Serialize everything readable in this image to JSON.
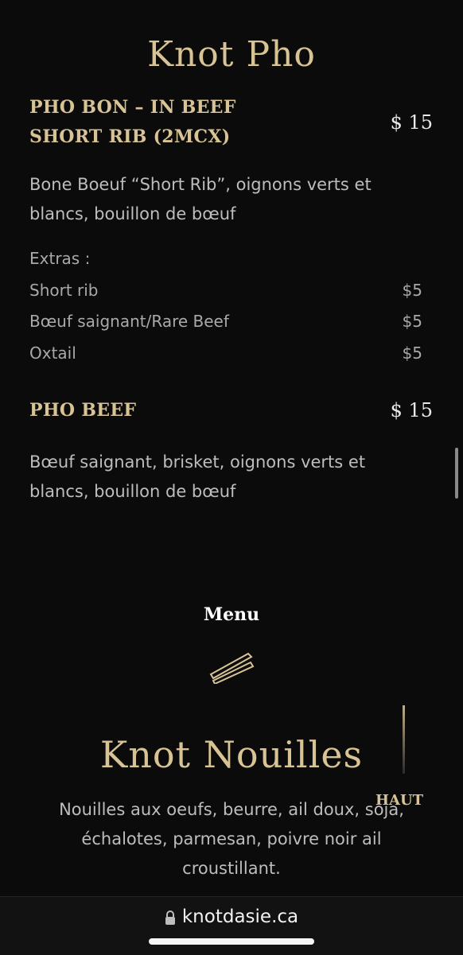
{
  "section1": {
    "title": "Knot Pho",
    "items": [
      {
        "name": "PHO BON – IN BEEF SHORT RIB (2MCX)",
        "price": "$ 15",
        "description": "Bone Boeuf “Short Rib”, oignons verts et blancs, bouillon de bœuf",
        "extras_label": "Extras :",
        "extras": [
          {
            "name": "Short rib",
            "price": "$5"
          },
          {
            "name": "Bœuf saignant/Rare Beef",
            "price": "$5"
          },
          {
            "name": "Oxtail",
            "price": "$5"
          }
        ]
      },
      {
        "name": "PHO BEEF",
        "price": "$ 15",
        "description": "Bœuf saignant, brisket, oignons verts et blancs, bouillon de bœuf"
      }
    ]
  },
  "menu_label": "Menu",
  "section2": {
    "title": "Knot Nouilles",
    "description": "Nouilles aux oeufs, beurre, ail doux, soja, échalotes, parmesan, poivre noir ail croustillant."
  },
  "back_to_top": "HAUT",
  "browser": {
    "url": "knotdasie.ca"
  },
  "colors": {
    "background": "#0b0b0b",
    "accent_gold": "#d8c394"
  }
}
